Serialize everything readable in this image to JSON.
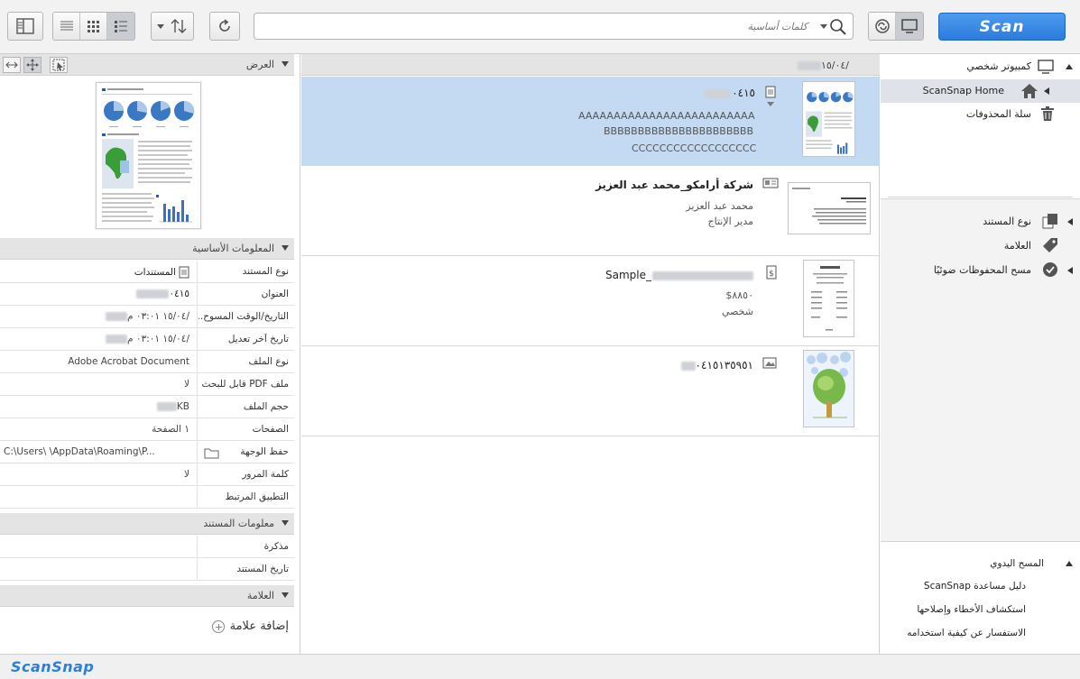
{
  "toolbar": {
    "search_placeholder": "كلمات أساسية",
    "scan_label": "Scan"
  },
  "preview": {
    "header": "العرض"
  },
  "basic_info": {
    "header": "المعلومات الأساسية",
    "rows": [
      {
        "label": "نوع المستند",
        "value": "المستندات"
      },
      {
        "label": "العنوان",
        "value": "٠٤١٥"
      },
      {
        "label": "التاريخ/الوقت المسوح...",
        "value": "/١٥/٠٤ ٠٣:٠١ م"
      },
      {
        "label": "تاريخ آخر تعديل",
        "value": "/١٥/٠٤ ٠٣:٠١ م"
      },
      {
        "label": "نوع الملف",
        "value": "Adobe Acrobat Document"
      },
      {
        "label": "ملف PDF قابل للبحث فيه",
        "value": "لا"
      },
      {
        "label": "حجم الملف",
        "value": "KB"
      },
      {
        "label": "الصفحات",
        "value": "١ الصفحة"
      },
      {
        "label": "حفظ الوجهة",
        "value": "C:\\Users\\  \\AppData\\Roaming\\P..."
      },
      {
        "label": "كلمة المرور",
        "value": "لا"
      },
      {
        "label": "التطبيق المرتبط",
        "value": ""
      }
    ]
  },
  "doc_info": {
    "header": "معلومات المستند",
    "rows": [
      {
        "label": "مذكرة",
        "value": ""
      },
      {
        "label": "تاريخ المستند",
        "value": ""
      }
    ]
  },
  "tags": {
    "header": "العلامة",
    "add_label": "إضافة علامة"
  },
  "list": {
    "date_header": "١٥/٠٤/",
    "items": [
      {
        "title": "٠٤١٥",
        "lines": [
          "AAAAAAAAAAAAAAAAAAAAAAAAA",
          "BBBBBBBBBBBBBBBBBBBBBB",
          "CCCCCCCCCCCCCCCCCC"
        ]
      },
      {
        "title": "شركة أرامكو_محمد عبد العزيز",
        "lines": [
          "محمد عبد العزيز",
          "مدير الإنتاج"
        ]
      },
      {
        "title": "Sample_",
        "lines": [
          "٨٨٥٠$",
          "شخصي"
        ]
      },
      {
        "title": "٠٤١٥١٣٥٩٥١",
        "lines": []
      }
    ]
  },
  "nav": {
    "pc": "كمبيوتر شخصي",
    "home": "ScanSnap Home",
    "trash": "سلة المحذوفات",
    "doc_type": "نوع المستند",
    "tag": "العلامة",
    "ocr": "مسح المحفوظات ضوئيًا",
    "manual": "المسح اليدوي",
    "guide": "دليل مساعدة ScanSnap",
    "troubleshoot": "استكشاف الأخطاء وإصلاحها",
    "howto": "الاستفسار عن كيفية استخدامه"
  },
  "status": {
    "logo": "ScanSnap"
  },
  "colors": {
    "accent": "#2a7bdc",
    "selection": "#c3daf2"
  }
}
